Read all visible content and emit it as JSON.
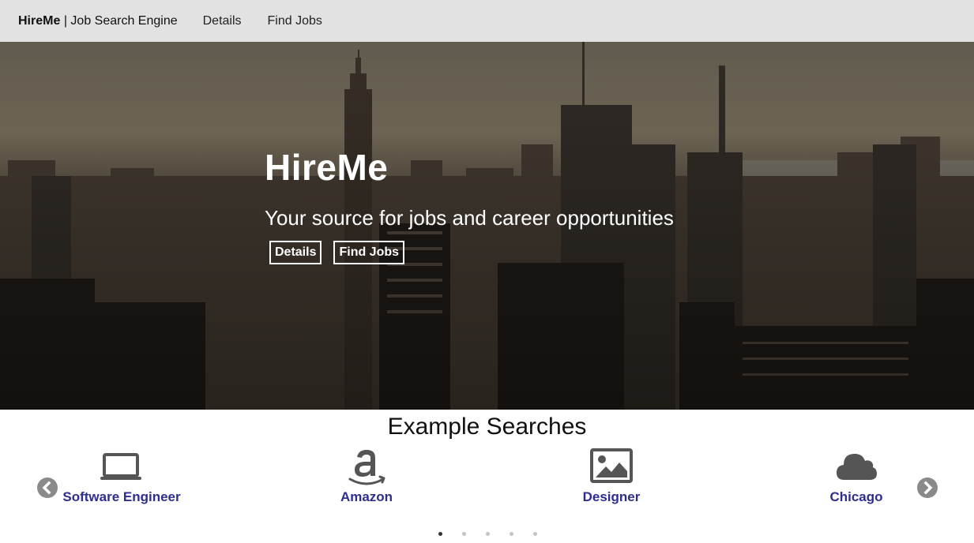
{
  "navbar": {
    "brand_name": "HireMe",
    "brand_tagline": "| Job Search Engine",
    "links": [
      "Details",
      "Find Jobs"
    ]
  },
  "hero": {
    "title": "HireMe",
    "subtitle": "Your source for jobs and career opportunities",
    "buttons": [
      "Details",
      "Find Jobs"
    ],
    "background_icon": "city-skyline-image"
  },
  "examples": {
    "heading": "Example Searches",
    "items": [
      {
        "label": "Software Engineer",
        "icon": "laptop-icon"
      },
      {
        "label": "Amazon",
        "icon": "amazon-icon"
      },
      {
        "label": "Designer",
        "icon": "image-icon"
      },
      {
        "label": "Chicago",
        "icon": "cloud-icon"
      }
    ],
    "carousel_pages": 5,
    "active_page": 1
  },
  "colors": {
    "navbar_bg": "#e2e2e2",
    "link_color": "#2e2e8f",
    "icon_gray": "#555555"
  }
}
